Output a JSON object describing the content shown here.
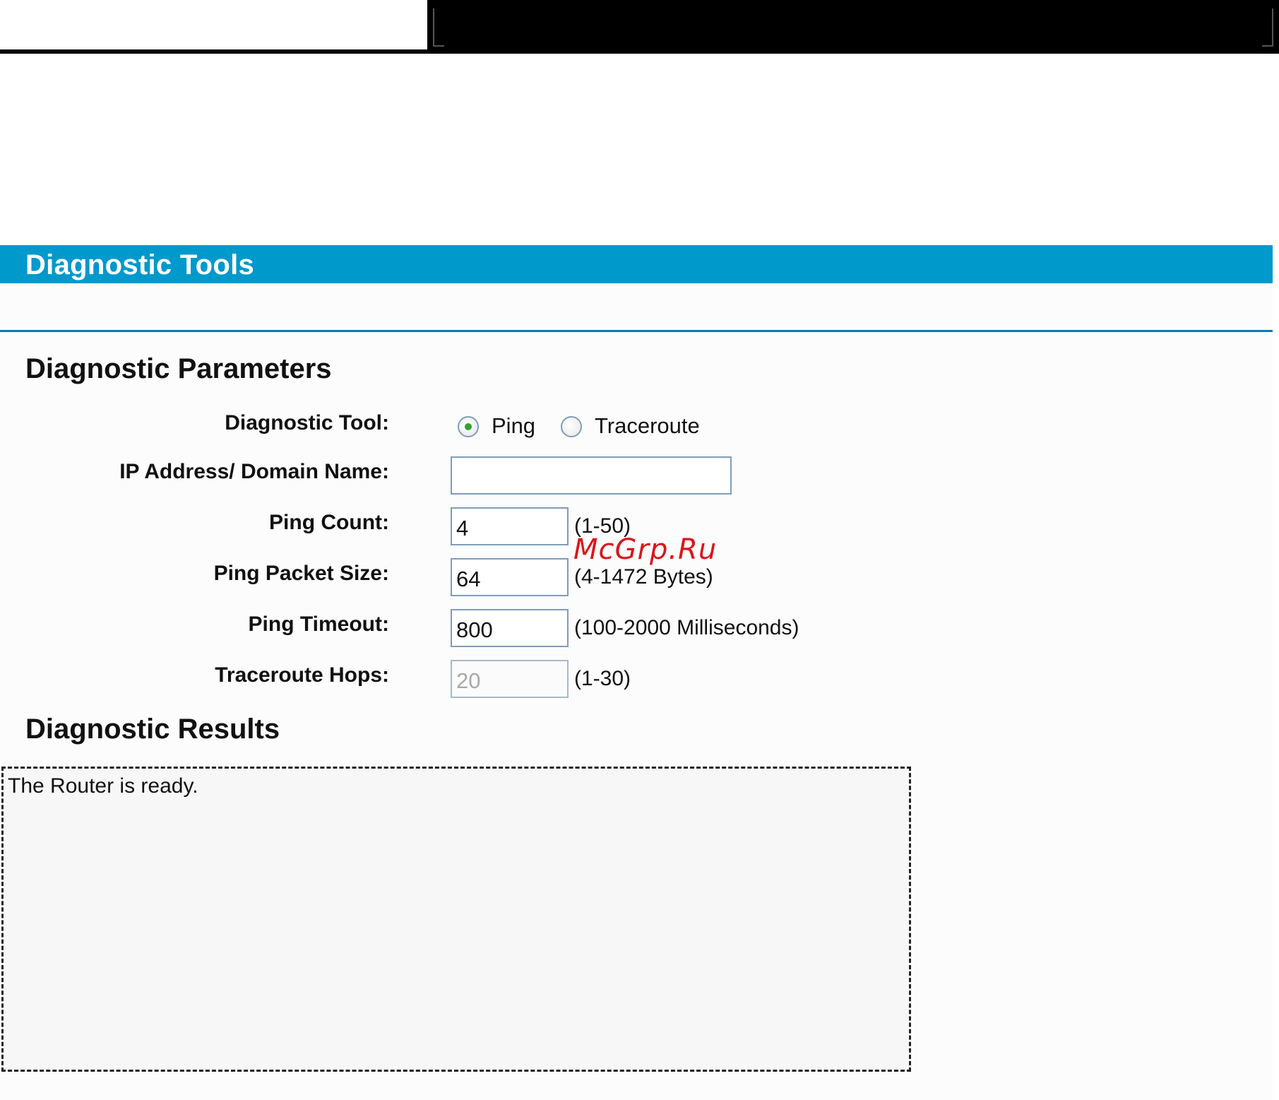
{
  "header": {
    "title": "Diagnostic Tools"
  },
  "parameters": {
    "section_title": "Diagnostic Parameters",
    "tool": {
      "label": "Diagnostic Tool:",
      "options": [
        {
          "label": "Ping",
          "selected": true
        },
        {
          "label": "Traceroute",
          "selected": false
        }
      ]
    },
    "ip": {
      "label": "IP Address/ Domain Name:",
      "value": ""
    },
    "ping_count": {
      "label": "Ping Count:",
      "value": "4",
      "hint": "(1-50)"
    },
    "packet_size": {
      "label": "Ping Packet Size:",
      "value": "64",
      "hint": "(4-1472 Bytes)"
    },
    "timeout": {
      "label": "Ping Timeout:",
      "value": "800",
      "hint": "(100-2000 Milliseconds)"
    },
    "hops": {
      "label": "Traceroute Hops:",
      "value": "20",
      "hint": "(1-30)",
      "disabled": true
    }
  },
  "results": {
    "section_title": "Diagnostic Results",
    "text": "The Router is ready."
  },
  "watermark": "McGrp.Ru",
  "colors": {
    "header_bg": "#0099cc",
    "divider": "#0d7ab0",
    "radio_selected": "#2fa32f",
    "watermark": "#d9161b"
  }
}
